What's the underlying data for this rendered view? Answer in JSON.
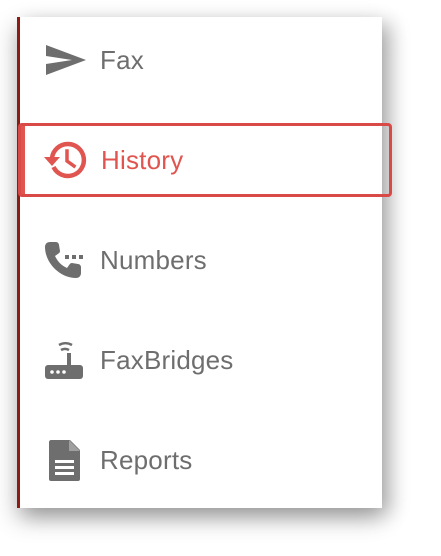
{
  "sidebar": {
    "items": [
      {
        "label": "Fax",
        "icon": "send-icon",
        "active": false
      },
      {
        "label": "History",
        "icon": "history-icon",
        "active": true
      },
      {
        "label": "Numbers",
        "icon": "phone-dialpad-icon",
        "active": false
      },
      {
        "label": "FaxBridges",
        "icon": "router-icon",
        "active": false
      },
      {
        "label": "Reports",
        "icon": "document-icon",
        "active": false
      }
    ]
  },
  "colors": {
    "active": "#e0554f",
    "inactive": "#6e6e6e",
    "left_rule": "#8e1b12"
  }
}
